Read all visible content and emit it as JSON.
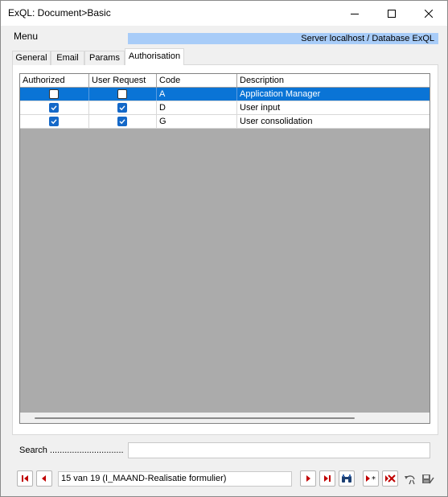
{
  "window": {
    "title": "ExQL: Document>Basic",
    "minimize_icon": "minimize-icon",
    "maximize_icon": "maximize-icon",
    "close_icon": "close-icon"
  },
  "menu": {
    "label": "Menu"
  },
  "server": {
    "text": "Server localhost / Database ExQL",
    "color": "#a8ccf8"
  },
  "tabs": [
    {
      "label": "General",
      "active": false
    },
    {
      "label": "Email",
      "active": false
    },
    {
      "label": "Params",
      "active": false
    },
    {
      "label": "Authorisation",
      "active": true
    }
  ],
  "grid": {
    "columns": [
      "Authorized",
      "User Request",
      "Code",
      "Description"
    ],
    "rows": [
      {
        "authorized": false,
        "user_request": false,
        "code": "A",
        "description": "Application Manager",
        "selected": true
      },
      {
        "authorized": true,
        "user_request": true,
        "code": "D",
        "description": "User input",
        "selected": false
      },
      {
        "authorized": true,
        "user_request": true,
        "code": "G",
        "description": "User consolidation",
        "selected": false
      }
    ],
    "selection_color": "#0a74d6",
    "checkbox_color": "#1468c8"
  },
  "search": {
    "label": "Search ..............................",
    "value": ""
  },
  "navigator": {
    "record_text": "15 van 19 (I_MAAND-Realisatie formulier)",
    "icons": [
      "first-record-icon",
      "prev-record-icon",
      "next-record-icon",
      "last-record-icon",
      "binoculars-icon",
      "new-record-icon",
      "delete-record-icon",
      "undo-icon",
      "save-icon"
    ]
  }
}
